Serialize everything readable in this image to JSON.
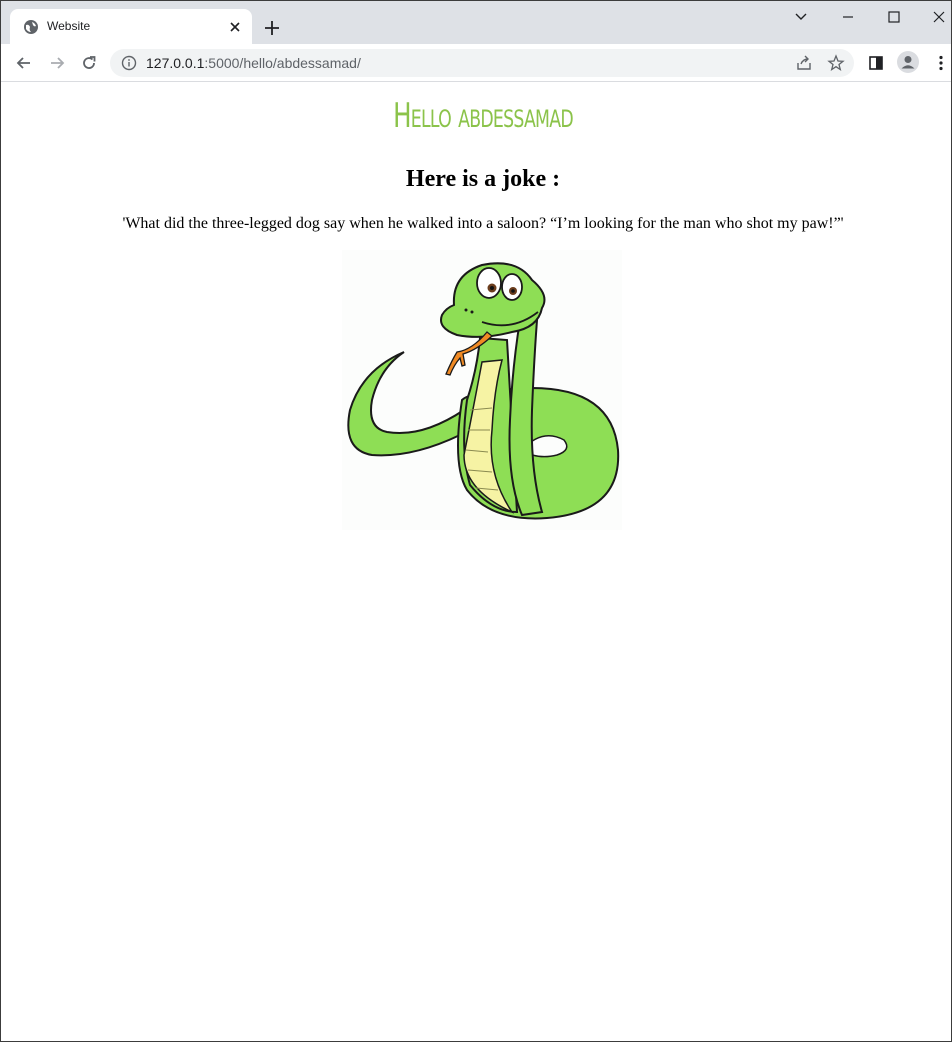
{
  "browser": {
    "tab_title": "Website",
    "url_host": "127.0.0.1",
    "url_path": ":5000/hello/abdessamad/"
  },
  "page": {
    "greeting": "Hello abdessamad",
    "joke_heading": "Here is a joke :",
    "joke_text": "'What did the three-legged dog say when he walked into a saloon? “I’m looking for the man who shot my paw!”'"
  },
  "colors": {
    "greeting": "#8bc34a",
    "snake_body": "#8ede55",
    "snake_belly": "#f6f3a4",
    "tongue": "#f08a24"
  },
  "icons": {
    "tab": "globe-icon",
    "close": "close-icon",
    "new_tab": "plus-icon",
    "back": "back-arrow-icon",
    "forward": "forward-arrow-icon",
    "reload": "reload-icon",
    "info": "info-icon",
    "share": "share-icon",
    "bookmark": "star-icon",
    "side_panel": "side-panel-icon",
    "profile": "profile-icon",
    "menu": "kebab-menu-icon"
  }
}
